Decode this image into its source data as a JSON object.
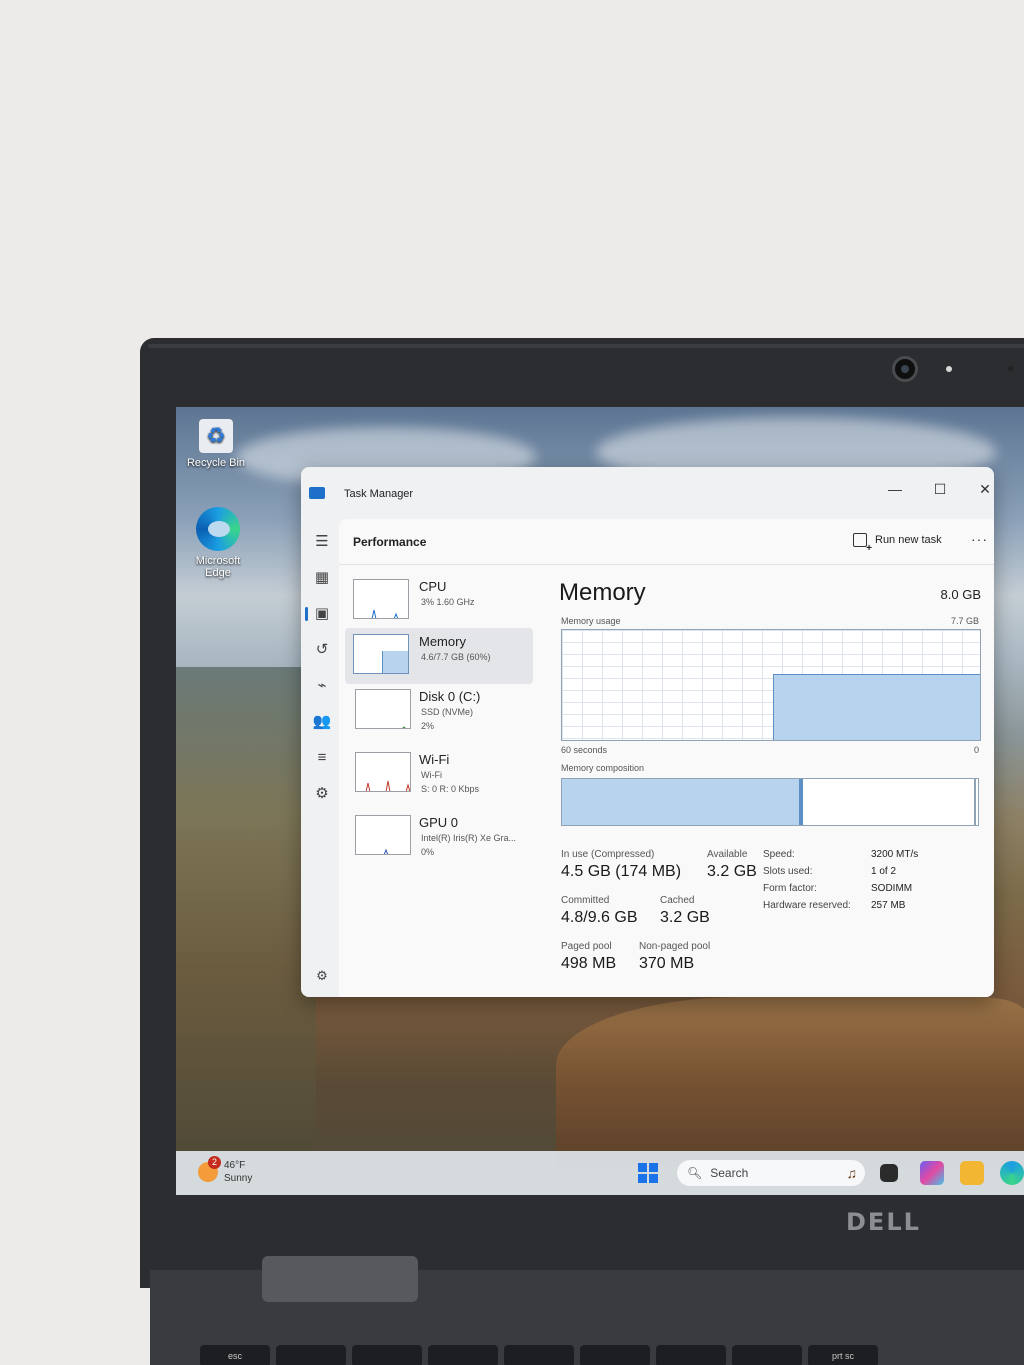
{
  "desktop": {
    "icons": [
      {
        "label": "Recycle Bin",
        "icon": "recycle-bin-icon"
      },
      {
        "label": "Microsoft Edge",
        "icon": "edge-icon"
      }
    ]
  },
  "window": {
    "title": "Task Manager",
    "controls": {
      "minimize": "—",
      "maximize": "☐",
      "close": "✕"
    }
  },
  "nav": {
    "items": [
      "menu-icon",
      "processes-icon",
      "performance-icon",
      "app-history-icon",
      "startup-apps-icon",
      "users-icon",
      "details-icon",
      "services-icon",
      "settings-icon"
    ],
    "active": "performance-icon"
  },
  "header": {
    "page_title": "Performance",
    "run_new_task": "Run new task",
    "more": "···"
  },
  "perf_list": [
    {
      "name": "CPU",
      "sub1": "3%  1.60 GHz",
      "sub2": "",
      "sub3": ""
    },
    {
      "name": "Memory",
      "sub1": "4.6/7.7 GB (60%)",
      "sub2": "",
      "sub3": ""
    },
    {
      "name": "Disk 0 (C:)",
      "sub1": "SSD (NVMe)",
      "sub2": "2%",
      "sub3": ""
    },
    {
      "name": "Wi-Fi",
      "sub1": "Wi-Fi",
      "sub2": "S: 0  R: 0 Kbps",
      "sub3": ""
    },
    {
      "name": "GPU 0",
      "sub1": "Intel(R) Iris(R) Xe Gra...",
      "sub2": "0%",
      "sub3": ""
    }
  ],
  "memory": {
    "title": "Memory",
    "total": "8.0 GB",
    "usage_label": "Memory usage",
    "usage_max": "7.7 GB",
    "time_left": "60 seconds",
    "time_right": "0",
    "usage_fraction": 0.6,
    "composition_label": "Memory composition",
    "composition_inuse_fraction": 0.58,
    "stats": {
      "in_use_label": "In use (Compressed)",
      "in_use_value": "4.5 GB (174 MB)",
      "available_label": "Available",
      "available_value": "3.2 GB",
      "committed_label": "Committed",
      "committed_value": "4.8/9.6 GB",
      "cached_label": "Cached",
      "cached_value": "3.2 GB",
      "paged_label": "Paged pool",
      "paged_value": "498 MB",
      "nonpaged_label": "Non-paged pool",
      "nonpaged_value": "370 MB"
    },
    "hw": [
      {
        "key": "Speed:",
        "value": "3200 MT/s"
      },
      {
        "key": "Slots used:",
        "value": "1 of 2"
      },
      {
        "key": "Form factor:",
        "value": "SODIMM"
      },
      {
        "key": "Hardware reserved:",
        "value": "257 MB"
      }
    ]
  },
  "taskbar": {
    "weather_temp": "46°F",
    "weather_desc": "Sunny",
    "weather_badge": "2",
    "search_placeholder": "Search"
  },
  "laptop": {
    "brand": "DELL",
    "keys": [
      "esc",
      "",
      "",
      "",
      "",
      "",
      "",
      "",
      "",
      "",
      "prt sc"
    ]
  }
}
